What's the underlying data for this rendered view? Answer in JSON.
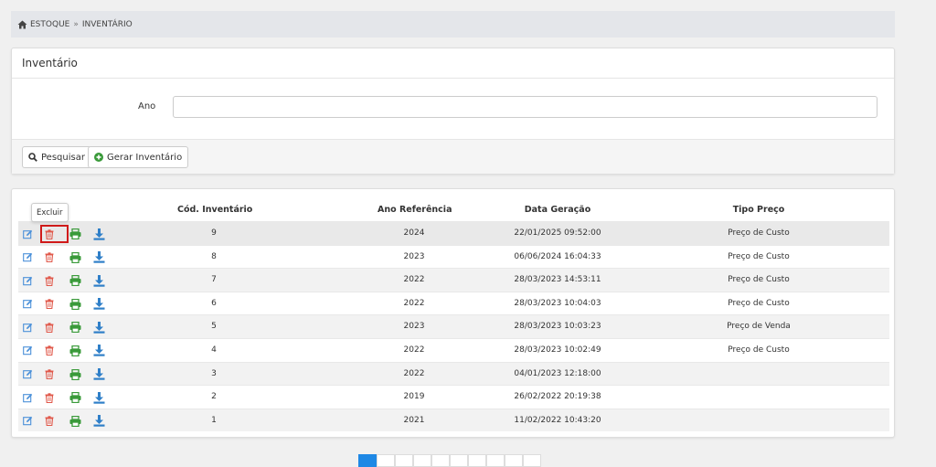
{
  "breadcrumb": {
    "items": [
      "ESTOQUE",
      "INVENTÁRIO"
    ],
    "separator": "»"
  },
  "panel": {
    "title": "Inventário",
    "field_label": "Ano",
    "field_value": "",
    "search_label": "Pesquisar",
    "generate_label": "Gerar Inventário"
  },
  "table": {
    "headers": {
      "cod": "Cód. Inventário",
      "ano": "Ano Referência",
      "data": "Data Geração",
      "tipo": "Tipo Preço"
    },
    "tooltip": "Excluir",
    "rows": [
      {
        "cod": "9",
        "ano": "2024",
        "data": "22/01/2025 09:52:00",
        "tipo": "Preço de Custo"
      },
      {
        "cod": "8",
        "ano": "2023",
        "data": "06/06/2024 16:04:33",
        "tipo": "Preço de Custo"
      },
      {
        "cod": "7",
        "ano": "2022",
        "data": "28/03/2023 14:53:11",
        "tipo": "Preço de Custo"
      },
      {
        "cod": "6",
        "ano": "2022",
        "data": "28/03/2023 10:04:03",
        "tipo": "Preço de Custo"
      },
      {
        "cod": "5",
        "ano": "2023",
        "data": "28/03/2023 10:03:23",
        "tipo": "Preço de Venda"
      },
      {
        "cod": "4",
        "ano": "2022",
        "data": "28/03/2023 10:02:49",
        "tipo": "Preço de Custo"
      },
      {
        "cod": "3",
        "ano": "2022",
        "data": "04/01/2023 12:18:00",
        "tipo": ""
      },
      {
        "cod": "2",
        "ano": "2019",
        "data": "26/02/2022 20:19:38",
        "tipo": ""
      },
      {
        "cod": "1",
        "ano": "2021",
        "data": "11/02/2022 10:43:20",
        "tipo": ""
      }
    ]
  },
  "colors": {
    "edit": "#4a90d9",
    "delete": "#e0584a",
    "print": "#3a9a3a",
    "download": "#2f7fc8",
    "active_page": "#1e88e5"
  },
  "icons": {
    "home": "home-icon",
    "search": "search-icon",
    "add": "plus-circle-icon",
    "edit": "edit-icon",
    "delete": "trash-icon",
    "print": "print-icon",
    "download": "download-icon"
  }
}
